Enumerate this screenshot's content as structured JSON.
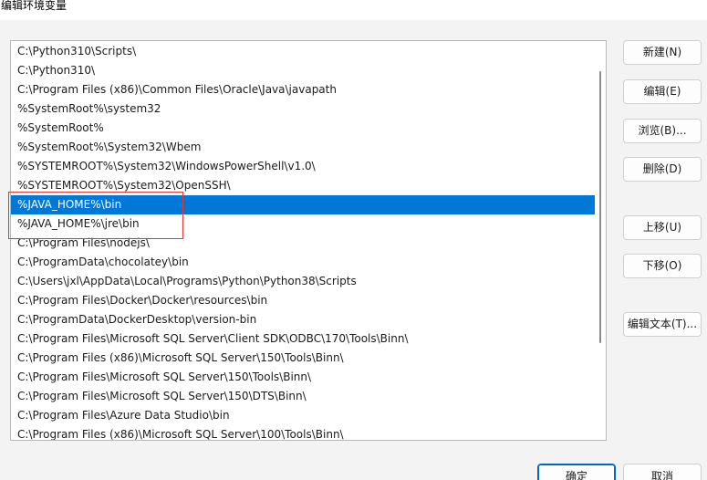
{
  "window": {
    "title": "编辑环境变量"
  },
  "path_list": {
    "items": [
      "C:\\Python310\\Scripts\\",
      "C:\\Python310\\",
      "C:\\Program Files (x86)\\Common Files\\Oracle\\Java\\javapath",
      "%SystemRoot%\\system32",
      "%SystemRoot%",
      "%SystemRoot%\\System32\\Wbem",
      "%SYSTEMROOT%\\System32\\WindowsPowerShell\\v1.0\\",
      "%SYSTEMROOT%\\System32\\OpenSSH\\",
      "%JAVA_HOME%\\bin",
      "%JAVA_HOME%\\jre\\bin",
      "C:\\Program Files\\nodejs\\",
      "C:\\ProgramData\\chocolatey\\bin",
      "C:\\Users\\jxl\\AppData\\Local\\Programs\\Python\\Python38\\Scripts",
      "C:\\Program Files\\Docker\\Docker\\resources\\bin",
      "C:\\ProgramData\\DockerDesktop\\version-bin",
      "C:\\Program Files\\Microsoft SQL Server\\Client SDK\\ODBC\\170\\Tools\\Binn\\",
      "C:\\Program Files (x86)\\Microsoft SQL Server\\150\\Tools\\Binn\\",
      "C:\\Program Files\\Microsoft SQL Server\\150\\Tools\\Binn\\",
      "C:\\Program Files\\Microsoft SQL Server\\150\\DTS\\Binn\\",
      "C:\\Program Files\\Azure Data Studio\\bin",
      "C:\\Program Files (x86)\\Microsoft SQL Server\\100\\Tools\\Binn\\"
    ],
    "selected_index": 8
  },
  "buttons": {
    "new": "新建(N)",
    "edit": "编辑(E)",
    "browse": "浏览(B)...",
    "delete": "删除(D)",
    "move_up": "上移(U)",
    "move_down": "下移(O)",
    "edit_text": "编辑文本(T)...",
    "ok": "确定",
    "cancel": "取消"
  },
  "colors": {
    "selection": "#0078d7",
    "annotation_box": "#e0392e"
  }
}
